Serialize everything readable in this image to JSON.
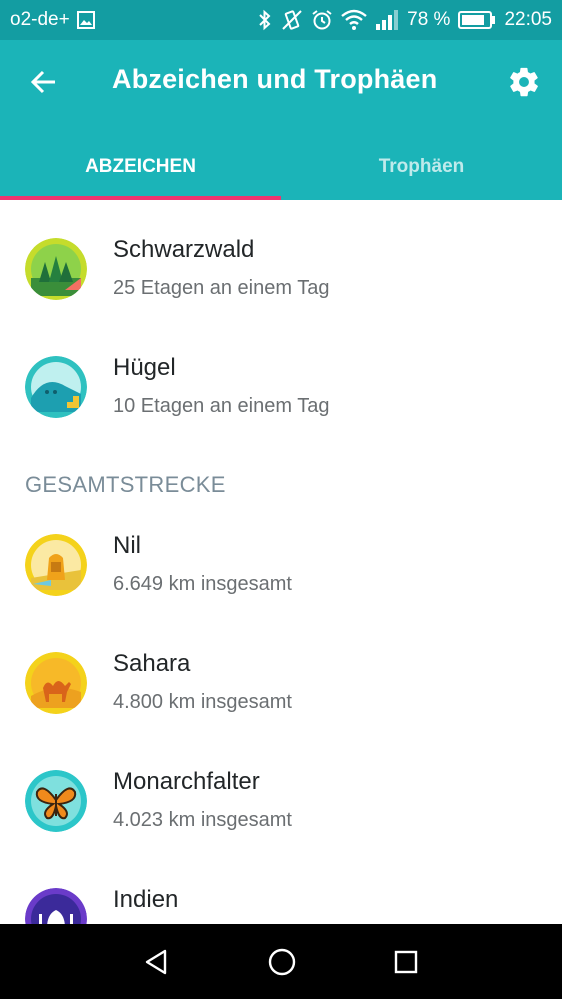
{
  "status_bar": {
    "carrier": "o2-de+",
    "battery_percent": "78 %",
    "time": "22:05",
    "icons": [
      "image-icon",
      "bluetooth-icon",
      "vibrate-icon",
      "alarm-icon",
      "wifi-icon",
      "signal-icon",
      "battery-icon"
    ]
  },
  "app_bar": {
    "title": "Abzeichen und Trophäen",
    "back_icon": "arrow-left-icon",
    "settings_icon": "gear-icon",
    "background": "#1bb4b8",
    "status_background": "#139da2"
  },
  "tabs": [
    {
      "label": "ABZEICHEN",
      "active": true
    },
    {
      "label": "Trophäen",
      "active": false
    }
  ],
  "indicator_color": "#f0336f",
  "list": {
    "floors": [
      {
        "title": "Schwarzwald",
        "subtitle": "25 Etagen an einem Tag",
        "badge": "forest-badge-icon"
      },
      {
        "title": "Hügel",
        "subtitle": "10 Etagen an einem Tag",
        "badge": "hill-badge-icon"
      }
    ],
    "section_title": "GESAMTSTRECKE",
    "distance": [
      {
        "title": "Nil",
        "subtitle": "6.649 km insgesamt",
        "badge": "sphinx-badge-icon"
      },
      {
        "title": "Sahara",
        "subtitle": "4.800 km insgesamt",
        "badge": "camel-badge-icon"
      },
      {
        "title": "Monarchfalter",
        "subtitle": "4.023 km insgesamt",
        "badge": "butterfly-badge-icon"
      },
      {
        "title": "Indien",
        "subtitle": "",
        "badge": "taj-mahal-badge-icon"
      }
    ]
  },
  "nav_bar": {
    "icons": [
      "back-triangle-icon",
      "home-circle-icon",
      "recents-square-icon"
    ]
  }
}
